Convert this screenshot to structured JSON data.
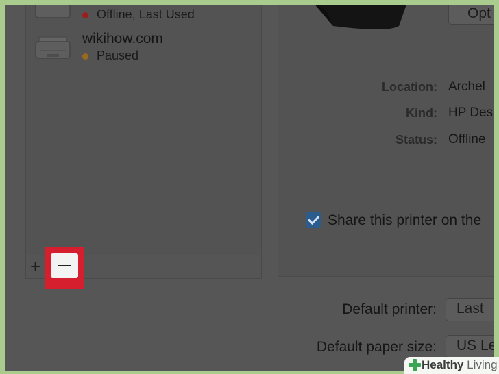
{
  "printers": [
    {
      "name": "",
      "status": "Offline, Last Used",
      "status_color": "#9c1d1d"
    },
    {
      "name": "wikihow.com",
      "status": "Paused",
      "status_color": "#9a6a1c"
    }
  ],
  "list_controls": {
    "add_symbol": "+",
    "remove_symbol": "−"
  },
  "details": {
    "options_button": "Opt",
    "rows": [
      {
        "label": "Location:",
        "value": "Archel"
      },
      {
        "label": "Kind:",
        "value": "HP Des"
      },
      {
        "label": "Status:",
        "value": "Offline"
      }
    ],
    "share_label": "Share this printer on the",
    "share_checked": true
  },
  "defaults": {
    "printer_label": "Default printer:",
    "printer_value": "Last",
    "paper_label": "Default paper size:",
    "paper_value": "US Le"
  },
  "watermark": {
    "brand": "Healthy",
    "brand2": "Living"
  },
  "colors": {
    "highlight": "#d51f2e",
    "checkbox": "#2a5c8e",
    "overlay_dim": "#565656"
  }
}
